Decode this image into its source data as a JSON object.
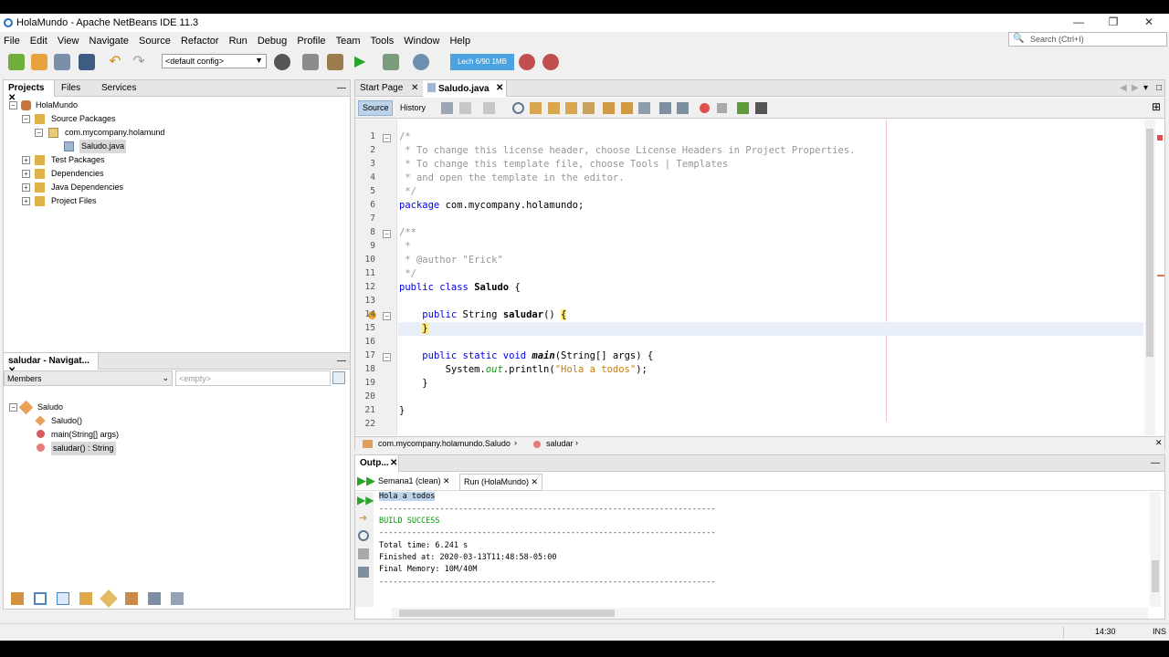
{
  "window": {
    "title": "HolaMundo - Apache NetBeans IDE 11.3",
    "min": "—",
    "max": "❐",
    "close": "✕"
  },
  "menu": [
    "File",
    "Edit",
    "View",
    "Navigate",
    "Source",
    "Refactor",
    "Run",
    "Debug",
    "Profile",
    "Team",
    "Tools",
    "Window",
    "Help"
  ],
  "search": {
    "placeholder": "Search (Ctrl+I)"
  },
  "toolbar": {
    "config": "<default config>",
    "memory": "Lech 6/90 1MB"
  },
  "projects": {
    "tabs": [
      "Projects",
      "Files",
      "Services"
    ],
    "tree": [
      {
        "label": "HolaMundo"
      },
      {
        "label": "Source Packages"
      },
      {
        "label": "com.mycompany.holamund"
      },
      {
        "label": "Saludo.java"
      },
      {
        "label": "Test Packages"
      },
      {
        "label": "Dependencies"
      },
      {
        "label": "Java Dependencies"
      },
      {
        "label": "Project Files"
      }
    ]
  },
  "navigator": {
    "title": "saludar - Navigat...",
    "members_label": "Members",
    "filter_placeholder": "<empty>",
    "items": [
      "Saludo",
      "Saludo()",
      "main(String[] args)",
      "saludar() : String"
    ]
  },
  "editor": {
    "tabs": [
      "Start Page",
      "Saludo.java"
    ],
    "modes": [
      "Source",
      "History"
    ],
    "breadcrumb": [
      "com.mycompany.holamundo.Saludo",
      "saludar"
    ],
    "line_numbers": [
      "1",
      "2",
      "3",
      "4",
      "5",
      "6",
      "7",
      "8",
      "9",
      "10",
      "11",
      "12",
      "13",
      "14",
      "15",
      "16",
      "17",
      "18",
      "19",
      "20",
      "21",
      "22"
    ]
  },
  "output": {
    "title": "Outp...",
    "tabs": [
      "Semana1 (clean)",
      "Run (HolaMundo)"
    ],
    "lines": [
      "Hola a todos",
      "------------------------------------------------------------------------",
      "BUILD SUCCESS",
      "------------------------------------------------------------------------",
      "Total time: 6.241 s",
      "Finished at: 2020-03-13T11:48:58-05:00",
      "Final Memory: 10M/40M",
      "------------------------------------------------------------------------"
    ]
  },
  "status": {
    "position": "14:30",
    "mode": "INS"
  }
}
